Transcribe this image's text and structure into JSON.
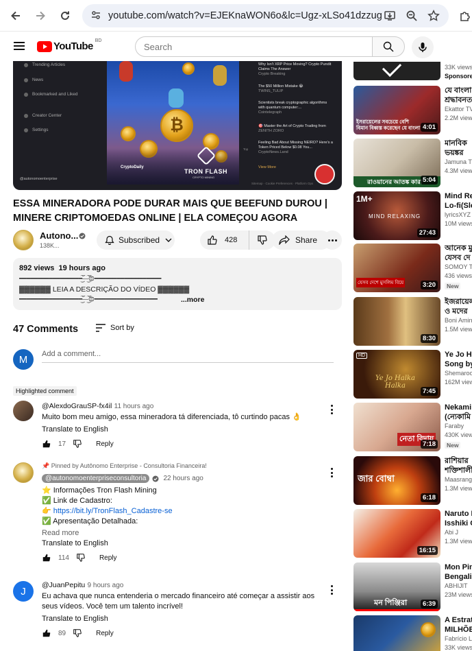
{
  "browser": {
    "url": "youtube.com/watch?v=EJEKnaWON6o&lc=Ugz-xLSo41dzzug..."
  },
  "header": {
    "logo_text": "YouTube",
    "country": "BD",
    "search_placeholder": "Search"
  },
  "video_frame": {
    "sidebar_items": [
      "Trending Articles",
      "News",
      "Bookmarked and Liked",
      "Creator Center",
      "Settings"
    ],
    "news": [
      {
        "title": "Why Isn't XRP Price Moving? Crypto Pundit Claims The Answer",
        "source": "Crypto Breaking"
      },
      {
        "title": "The $50 Million Mistake 😭",
        "source": "TWINS_TULIP"
      },
      {
        "title": "Scientists break cryptographic algorithms with quantum computer:...",
        "source": "Cointelegraph"
      },
      {
        "title": "🎯 Master the Art of Crypto Trading from",
        "source": "ZENITH ZORO"
      },
      {
        "title": "Feeling Bad About Missing NEIRO? Here's a Token Priced Below $0.08 You...",
        "source": "CryptoNews.Land"
      }
    ],
    "view_more": "View More",
    "footer_links": "Sitemap · Cookie Preferences · Platform Ops",
    "handle": "@autonomoenterprise",
    "brand_main": "TRON FLASH",
    "brand_sub": "CRYPTO MINING",
    "brand_logo": "CryptoDaily",
    "top_label": "Top"
  },
  "video": {
    "title": "ESSA MINERADORA PODE DURAR MAIS QUE BEEFUND DUROU | MINERE CRIPTOMOEDAS ONLINE | ELA COMEÇOU AGORA",
    "channel_name": "Autono...",
    "subscribers": "138K...",
    "subscribed_label": "Subscribed",
    "likes": "428",
    "share_label": "Share"
  },
  "description": {
    "views": "892 views",
    "time": "19 hours ago",
    "line1": "━━━━━━━━━━━━━━━━━━ۣۜۜ͜͡۞ۣۜۜ͜͡━━━━━━━━━━━━━━━━━━",
    "line2": "▓▓▓▓▓▓ LEIA A DESCRIÇÃO DO VÍDEO ▓▓▓▓▓▓",
    "line3": "━━━━━━━━━━━━━━━━━━ۣۜۜ͜͡۞ۣۜۜ͜͡━━━━━━━━━━━━━━━━━",
    "more": "...more"
  },
  "comments": {
    "count_label": "47 Comments",
    "sort_label": "Sort by",
    "add_placeholder": "Add a comment...",
    "user_initial": "M",
    "highlighted_label": "Highlighted comment",
    "items": [
      {
        "author": "@AlexdoGrauSP-fx4il",
        "time": "11 hours ago",
        "text": "Muito bom meu amigo, essa mineradora tá diferenciada, tô curtindo pacas 👌",
        "translate": "Translate to English",
        "likes": "17",
        "reply": "Reply"
      },
      {
        "pinned": "Pinned by Autônomo Enterprise - Consultoria Financeira!",
        "author": "@autonomoenterpriseconsultoria",
        "time": "22 hours ago",
        "lines": [
          "⭐ Informações Tron Flash Mining",
          "✅ Link de Cadastro:",
          "👉 https://bit.ly/TronFlash_Cadastre-se",
          "✅ Apresentação Detalhada:"
        ],
        "read_more": "Read more",
        "translate": "Translate to English",
        "likes": "114",
        "reply": "Reply"
      },
      {
        "author": "@JuanPepitu",
        "time": "9 hours ago",
        "initial": "J",
        "text": "Eu achava que nunca entenderia o mercado financeiro até começar a assistir aos seus vídeos. Você tem um talento incrível!",
        "translate": "Translate to English",
        "likes": "89",
        "reply": "Reply"
      }
    ]
  },
  "recommendations": [
    {
      "title": "",
      "channel": "33K views",
      "extra": "Sponsored",
      "duration": ""
    },
    {
      "title": "যে বাংলা",
      "title2": "শ্রদ্ধাবনত",
      "channel": "Ekattor TV",
      "stats": "2.2M views",
      "duration": "4:01",
      "overlay": "ইসরায়েলের সবচেয়ে বেশি বিমান বিধ্বস্ত করেছেন যে বাংলা"
    },
    {
      "title": "মানবিক",
      "title2": "ভয়ঙ্কর",
      "channel": "Jamuna TV",
      "stats": "4.3M views",
      "duration": "5:04",
      "overlay": "রাওয়ানের আতঙ্ক কারা"
    },
    {
      "title": "Mind Rel",
      "title2": "Lo-fi(Slo",
      "channel": "lyricsXYZ",
      "stats": "10M views",
      "duration": "27:43",
      "overlay": "MIND RELAXING"
    },
    {
      "title": "আনেক মু",
      "title2": "যেসব দে",
      "channel": "SOMOY TV",
      "stats": "436 views",
      "badge": "New",
      "duration": "3:20",
      "overlay": "যেসব দেশে মুসলিম বিয়ে"
    },
    {
      "title": "ইজরায়েল",
      "title2": "ও মদের",
      "channel": "Boni Amin",
      "stats": "1.5M views",
      "duration": "8:30"
    },
    {
      "title": "Ye Jo Ha",
      "title2": "Song by",
      "channel": "Shemaroo",
      "stats": "162M views",
      "duration": "7:45",
      "overlay": "Ye Jo Halka Halka"
    },
    {
      "title": "Nekami",
      "title2": "(ন্যেকামি",
      "channel": "Faraby",
      "stats": "430K views",
      "badge": "New",
      "duration": "7:18",
      "overlay": "নেতা বিদায়"
    },
    {
      "title": "রাশিয়ার",
      "title2": "শক্তিশালী",
      "channel": "Maasranga",
      "stats": "1.3M views",
      "duration": "6:18",
      "overlay": "জার বোম্বা"
    },
    {
      "title": "Naruto M",
      "title2": "Isshiki O",
      "channel": "Abi J",
      "stats": "1.3M views",
      "duration": "16:15"
    },
    {
      "title": "Mon Pinj",
      "title2": "Bengali",
      "channel": "ABHIJIT",
      "stats": "23M views",
      "duration": "6:39",
      "overlay": "মন পিঞ্জিরা"
    },
    {
      "title": "A Estrat",
      "title2": "MILHÕE",
      "channel": "Fabrício L",
      "stats": "33K views",
      "duration": ""
    }
  ],
  "colors": {
    "yt_red": "#ff0000",
    "link_blue": "#065fd4",
    "avatar_blue": "#1565c0"
  }
}
